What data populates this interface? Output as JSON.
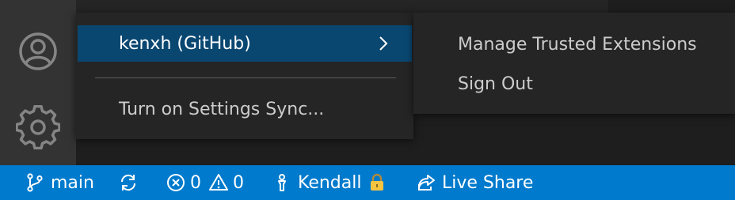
{
  "activity_bar": {
    "account_icon": "account-icon",
    "settings_icon": "gear-icon"
  },
  "accounts_menu": {
    "account_label": "kenxh (GitHub)",
    "settings_sync_label": "Turn on Settings Sync..."
  },
  "account_submenu": {
    "items": [
      {
        "label": "Manage Trusted Extensions"
      },
      {
        "label": "Sign Out"
      }
    ]
  },
  "status_bar": {
    "branch": "main",
    "errors": "0",
    "warnings": "0",
    "user": "Kendall",
    "live_share": "Live Share"
  },
  "colors": {
    "status_bar_bg": "#007acc",
    "menu_selection": "#094771",
    "menu_bg": "#252526"
  }
}
